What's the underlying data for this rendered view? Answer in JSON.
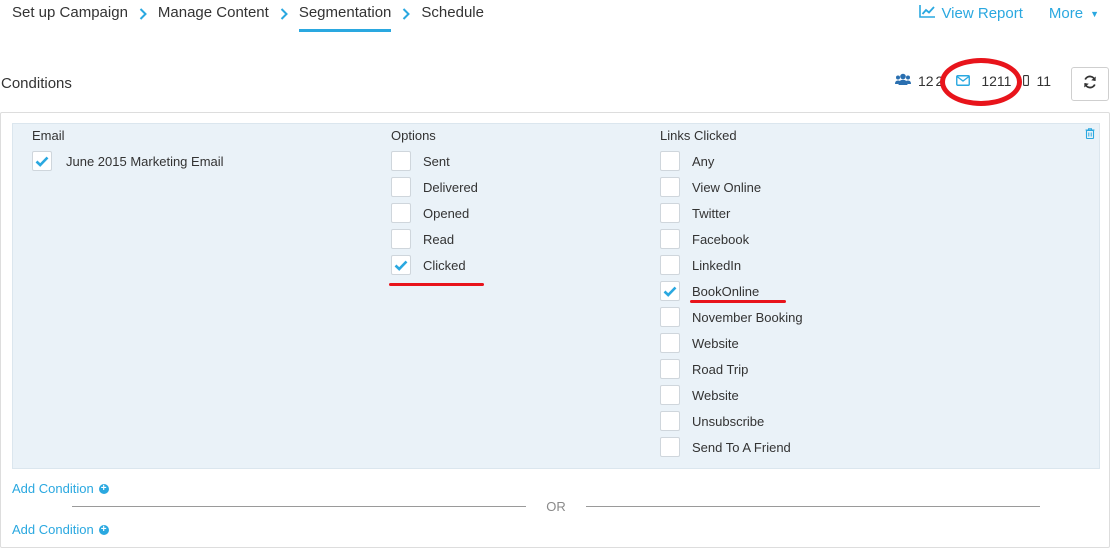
{
  "wizard": {
    "steps": [
      {
        "label": "Set up Campaign"
      },
      {
        "label": "Manage Content"
      },
      {
        "label": "Segmentation",
        "active": true
      },
      {
        "label": "Schedule"
      }
    ]
  },
  "header": {
    "view_report_label": "View Report",
    "more_label": "More"
  },
  "conditions": {
    "title": "Conditions",
    "stats": {
      "contacts": "12",
      "contacts_partial": "2",
      "emails": "1211",
      "other": "11"
    },
    "columns": {
      "email": {
        "title": "Email",
        "items": [
          {
            "label": "June 2015 Marketing Email",
            "checked": true
          }
        ]
      },
      "options": {
        "title": "Options",
        "items": [
          {
            "label": "Sent",
            "checked": false
          },
          {
            "label": "Delivered",
            "checked": false
          },
          {
            "label": "Opened",
            "checked": false
          },
          {
            "label": "Read",
            "checked": false
          },
          {
            "label": "Clicked",
            "checked": true
          }
        ]
      },
      "links": {
        "title": "Links Clicked",
        "items": [
          {
            "label": "Any",
            "checked": false
          },
          {
            "label": "View Online",
            "checked": false
          },
          {
            "label": "Twitter",
            "checked": false
          },
          {
            "label": "Facebook",
            "checked": false
          },
          {
            "label": "LinkedIn",
            "checked": false
          },
          {
            "label": "BookOnline",
            "checked": true
          },
          {
            "label": "November Booking",
            "checked": false
          },
          {
            "label": "Website",
            "checked": false
          },
          {
            "label": "Road Trip",
            "checked": false
          },
          {
            "label": "Website",
            "checked": false
          },
          {
            "label": "Unsubscribe",
            "checked": false
          },
          {
            "label": "Send To A Friend",
            "checked": false
          }
        ]
      }
    },
    "add_condition_label": "Add Condition",
    "or_label": "OR"
  },
  "colors": {
    "accent": "#2aa8e0",
    "annotation_red": "#e8141b",
    "panel_bg": "#eaf2f8"
  }
}
